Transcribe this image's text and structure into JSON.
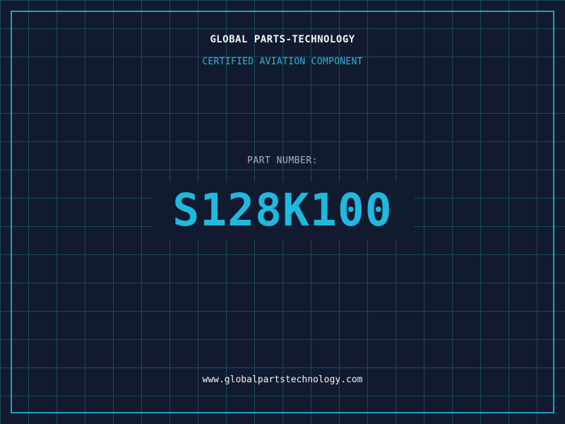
{
  "header": {
    "company": "GLOBAL PARTS-TECHNOLOGY",
    "subtitle": "CERTIFIED AVIATION COMPONENT"
  },
  "part": {
    "label": "PART NUMBER:",
    "number": "S128K100"
  },
  "footer": {
    "url": "www.globalpartstechnology.com"
  },
  "colors": {
    "background": "#111a2e",
    "grid": "#1a4a5e",
    "frame": "#1aa3c8",
    "accent": "#1fb8df"
  }
}
